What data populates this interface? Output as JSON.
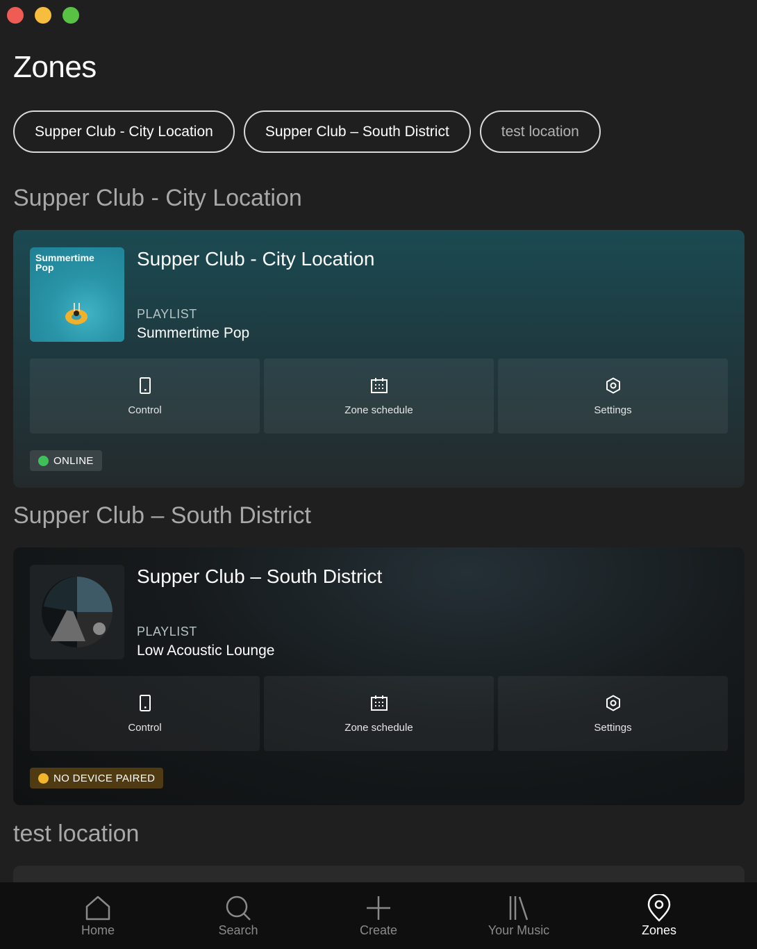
{
  "window": {
    "controls": [
      "close",
      "minimize",
      "maximize"
    ]
  },
  "page": {
    "title": "Zones"
  },
  "chips": [
    {
      "label": "Supper Club - City Location"
    },
    {
      "label": "Supper Club – South District"
    },
    {
      "label": "test location"
    }
  ],
  "sections": [
    {
      "title": "Supper Club - City Location",
      "zone_name": "Supper Club - City Location",
      "thumb_text": "Summertime Pop",
      "playlist_label": "PLAYLIST",
      "playlist_name": "Summertime Pop",
      "actions": {
        "control": "Control",
        "schedule": "Zone schedule",
        "settings": "Settings"
      },
      "status": {
        "text": "ONLINE",
        "color": "#3fc159"
      }
    },
    {
      "title": "Supper Club – South District",
      "zone_name": "Supper Club – South District",
      "playlist_label": "PLAYLIST",
      "playlist_name": "Low Acoustic Lounge",
      "actions": {
        "control": "Control",
        "schedule": "Zone schedule",
        "settings": "Settings"
      },
      "status": {
        "text": "NO DEVICE PAIRED",
        "color": "#f1b62a"
      }
    },
    {
      "title": "test location"
    }
  ],
  "nav": [
    {
      "label": "Home",
      "icon": "home-icon"
    },
    {
      "label": "Search",
      "icon": "search-icon"
    },
    {
      "label": "Create",
      "icon": "plus-icon"
    },
    {
      "label": "Your Music",
      "icon": "library-icon"
    },
    {
      "label": "Zones",
      "icon": "location-pin-icon",
      "active": true
    }
  ]
}
